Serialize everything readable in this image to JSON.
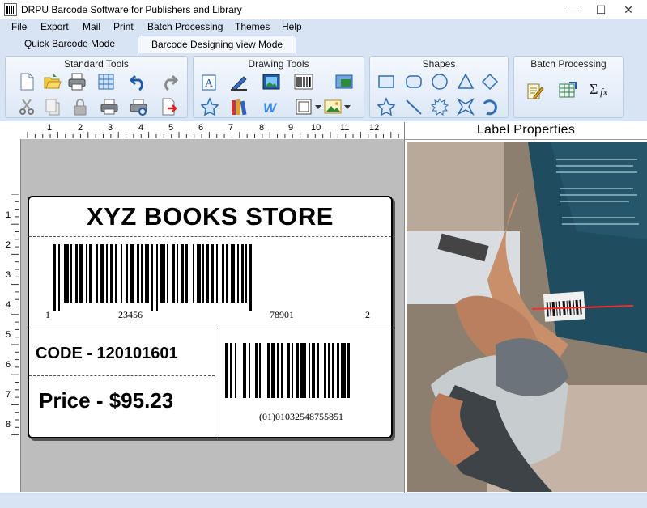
{
  "window": {
    "title": "DRPU Barcode Software for Publishers and Library",
    "minimize": "—",
    "maximize": "☐",
    "close": "✕"
  },
  "menu": [
    "File",
    "Export",
    "Mail",
    "Print",
    "Batch Processing",
    "Themes",
    "Help"
  ],
  "tabs": [
    {
      "label": "Quick Barcode Mode",
      "active": false
    },
    {
      "label": "Barcode Designing view Mode",
      "active": true
    }
  ],
  "toolbar_groups": {
    "standard": {
      "title": "Standard Tools",
      "tools": [
        "new-icon",
        "open-icon",
        "print-setup-icon",
        "grid-icon",
        "undo-icon",
        "redo-icon",
        "cut-icon",
        "copy-icon",
        "lock-icon",
        "print-icon",
        "print-preview-icon",
        "export-icon"
      ]
    },
    "drawing": {
      "title": "Drawing Tools",
      "tools": [
        "text-icon",
        "pen-icon",
        "picture-icon",
        "barcode-icon",
        "image-library-icon",
        "star-shape-icon",
        "books-icon",
        "wordart-icon",
        "frame-icon",
        "image-dropdown-icon"
      ]
    },
    "shapes": {
      "title": "Shapes",
      "tools": [
        "rectangle-icon",
        "rounded-rectangle-icon",
        "ellipse-icon",
        "triangle-icon",
        "diamond-icon",
        "star-icon",
        "line-icon",
        "burst-icon",
        "four-point-star-icon",
        "arc-icon"
      ]
    },
    "batch": {
      "title": "Batch Processing",
      "tools": [
        "edit-sheet-icon",
        "excel-import-icon",
        "formula-icon"
      ]
    }
  },
  "rulers": {
    "horizontal": [
      "1",
      "2",
      "3",
      "4",
      "5",
      "6",
      "7",
      "8",
      "9",
      "10",
      "11",
      "12"
    ],
    "vertical": [
      "1",
      "2",
      "3",
      "4",
      "5",
      "6",
      "7",
      "8"
    ]
  },
  "label": {
    "store_name": "XYZ BOOKS STORE",
    "barcode1": {
      "left": "1",
      "group1": "23456",
      "group2": "78901",
      "right": "2"
    },
    "code_line": "CODE - 120101601",
    "price_line": "Price - $95.23",
    "barcode2_text": "(01)01032548755851"
  },
  "properties_panel": {
    "title": "Label Properties"
  },
  "colors": {
    "chrome": "#d8e4f4",
    "canvas": "#bdbdbd",
    "accent": "#9fb6d8"
  }
}
